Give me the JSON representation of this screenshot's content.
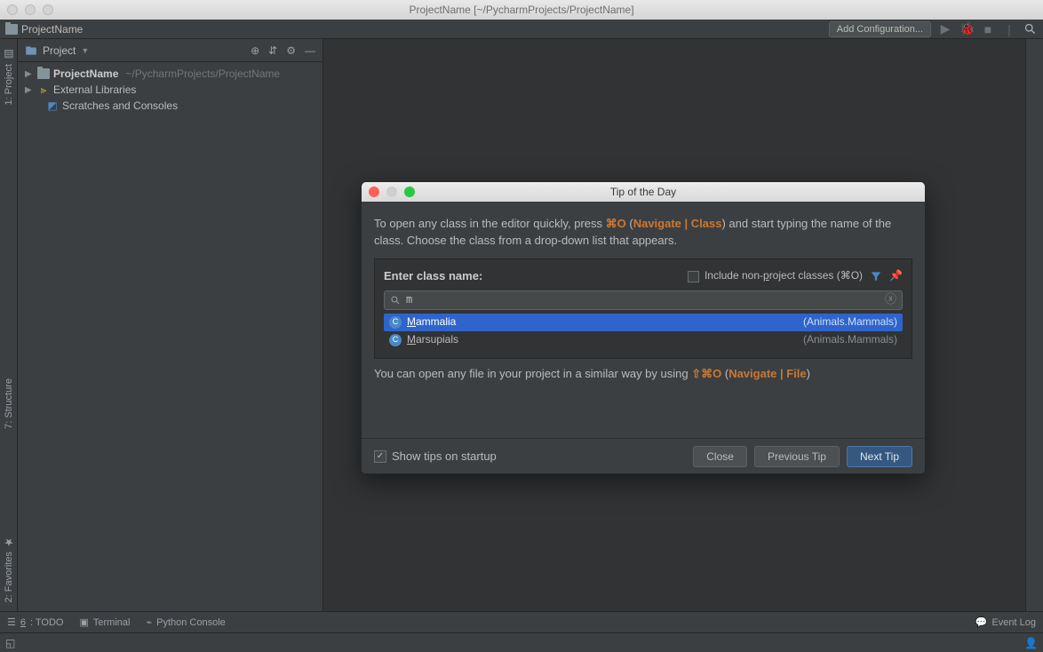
{
  "window": {
    "title": "ProjectName [~/PycharmProjects/ProjectName]"
  },
  "nav": {
    "breadcrumb": "ProjectName",
    "add_config_label": "Add Configuration..."
  },
  "project_panel": {
    "header_label": "Project",
    "tree": {
      "root_name": "ProjectName",
      "root_path": "~/PycharmProjects/ProjectName",
      "external_libs": "External Libraries",
      "scratches": "Scratches and Consoles"
    }
  },
  "gutter": {
    "project": "1: Project",
    "structure": "7: Structure",
    "favorites": "2: Favorites"
  },
  "bottom": {
    "todo": "6: TODO",
    "terminal": "Terminal",
    "py_console": "Python Console",
    "event_log": "Event Log"
  },
  "dialog": {
    "title": "Tip of the Day",
    "tip_pre": "To open any class in the editor quickly, press ",
    "tip_key1": "⌘O",
    "tip_mid1": " (",
    "tip_link1": "Navigate | Class",
    "tip_mid2": ") and start typing the name of the class. Choose the class from a drop-down list that appears.",
    "search_label": "Enter class name:",
    "include_label": "Include non-project classes (⌘O)",
    "search_value": "m",
    "results": [
      {
        "name": "Mammalia",
        "loc": "(Animals.Mammals)",
        "selected": true
      },
      {
        "name": "Marsupials",
        "loc": "(Animals.Mammals)",
        "selected": false
      }
    ],
    "tip2_pre": "You can open any file in your project in a similar way by using ",
    "tip2_key": "⇧⌘O",
    "tip2_mid1": " (",
    "tip2_link": "Navigate | File",
    "tip2_mid2": ")",
    "show_tips_label": "Show tips on startup",
    "close_label": "Close",
    "prev_label": "Previous Tip",
    "next_label": "Next Tip"
  }
}
